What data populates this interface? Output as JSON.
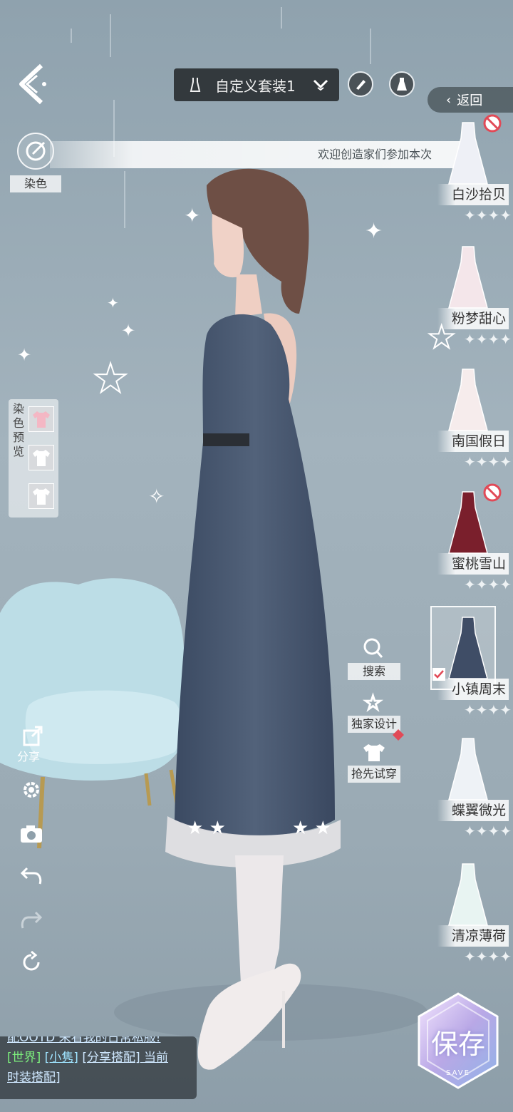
{
  "header": {
    "outfit_name": "自定义套装1",
    "return_label": "返回"
  },
  "dye": {
    "label": "染色",
    "preview_label": "染色预览",
    "swatch_colors": [
      "#f4b7c4",
      "#ffffff",
      "#ffffff"
    ]
  },
  "marquee": {
    "text": "欢迎创造家们参加本次"
  },
  "outfit_list": [
    {
      "name": "白沙拾贝",
      "locked": true,
      "selected": false,
      "stars": 4
    },
    {
      "name": "粉梦甜心",
      "locked": false,
      "selected": false,
      "stars": 4
    },
    {
      "name": "南国假日",
      "locked": false,
      "selected": false,
      "stars": 4
    },
    {
      "name": "蜜桃雪山",
      "locked": true,
      "selected": false,
      "stars": 4
    },
    {
      "name": "小镇周末",
      "locked": false,
      "selected": true,
      "stars": 4
    },
    {
      "name": "蝶翼微光",
      "locked": false,
      "selected": false,
      "stars": 4
    },
    {
      "name": "清凉薄荷",
      "locked": false,
      "selected": false,
      "stars": 4
    }
  ],
  "mid_buttons": {
    "search": "搜索",
    "exclusive": "独家设计",
    "try_on": "抢先试穿"
  },
  "side_tools": {
    "share": "分享"
  },
  "chat": {
    "line0": "配OOTD 来看我的日常私服!",
    "channel": "[世界]",
    "user": "[小隽]",
    "msg_link": "[分享搭配]",
    "msg_rest": " 当前",
    "line3": "时装搭配]"
  },
  "save": {
    "label": "保存",
    "sublabel": "SAVE"
  },
  "colors": {
    "accent": "#33393d",
    "chat_channel": "#7df07d",
    "chat_user": "#9fe3ff",
    "ban": "#e14a57"
  }
}
